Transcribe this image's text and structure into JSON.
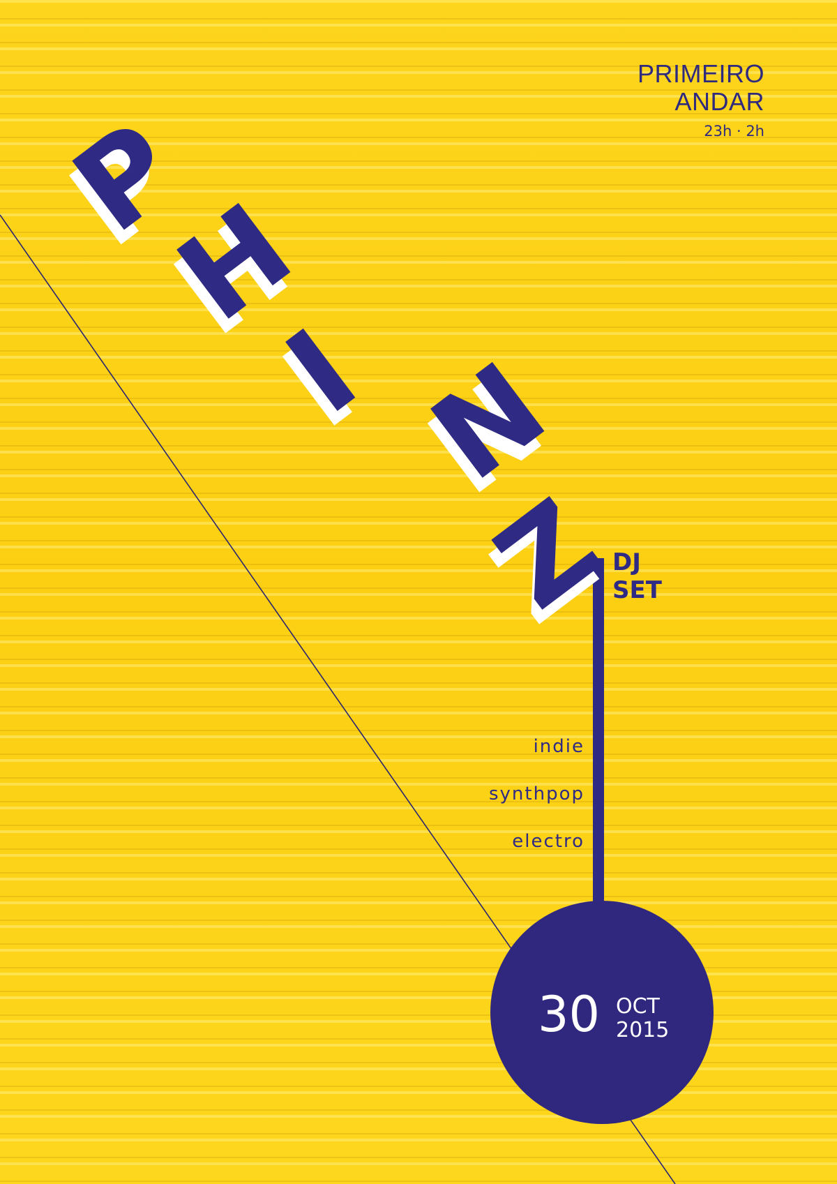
{
  "venue": {
    "line1": "PRIMEIRO",
    "line2": "ANDAR",
    "hours": "23h · 2h"
  },
  "title_letters": [
    "P",
    "H",
    "I",
    "N",
    "Z"
  ],
  "event_type": {
    "line1": "DJ",
    "line2": "SET"
  },
  "genres": [
    "indie",
    "synthpop",
    "electro"
  ],
  "date": {
    "day": "30",
    "month": "OCT",
    "year": "2015"
  },
  "colors": {
    "background": "#fcd116",
    "ink": "#2f2a84",
    "shadow": "#ffffff"
  }
}
